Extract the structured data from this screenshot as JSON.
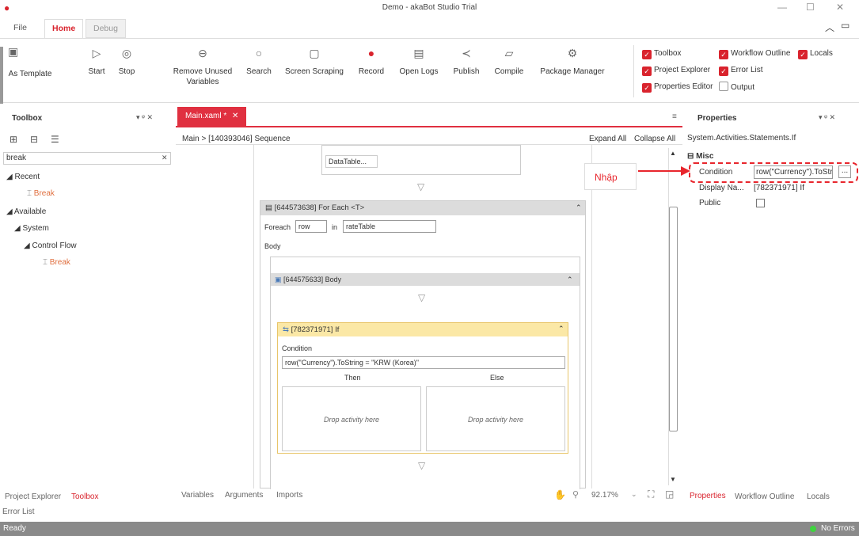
{
  "window": {
    "title": "Demo - akaBot Studio Trial"
  },
  "menu": {
    "file": "File",
    "home": "Home",
    "debug": "Debug"
  },
  "ribbon": {
    "as_template": "As Template",
    "start": "Start",
    "stop": "Stop",
    "remove_unused": "Remove Unused\nVariables",
    "search": "Search",
    "screen_scraping": "Screen Scraping",
    "record": "Record",
    "open_logs": "Open Logs",
    "publish": "Publish",
    "compile": "Compile",
    "package_manager": "Package Manager"
  },
  "panels": {
    "toolbox": "Toolbox",
    "workflow_outline": "Workflow Outline",
    "locals": "Locals",
    "project_explorer": "Project Explorer",
    "error_list": "Error List",
    "properties_editor": "Properties Editor",
    "output": "Output"
  },
  "toolbox": {
    "title": "Toolbox",
    "search_value": "break",
    "recent": "Recent",
    "break1": "Break",
    "available": "Available",
    "system": "System",
    "control_flow": "Control Flow",
    "break2": "Break"
  },
  "designer": {
    "tab": "Main.xaml *",
    "crumb": "Main > [140393046] Sequence",
    "expand": "Expand All",
    "collapse": "Collapse All",
    "datatable": "DataTable...",
    "foreach_title": "[644573638] For Each <T>",
    "foreach_label": "Foreach",
    "row": "row",
    "in_label": "in",
    "table": "rateTable",
    "body_label": "Body",
    "body_title": "[644575633] Body",
    "if_title": "[782371971] If",
    "condition_label": "Condition",
    "condition_value": "row(\"Currency\").ToString = \"KRW (Korea)\"",
    "then": "Then",
    "else": "Else",
    "drop1": "Drop activity here",
    "drop2": "Drop activity here"
  },
  "bottom": {
    "variables": "Variables",
    "arguments": "Arguments",
    "imports": "Imports",
    "zoom": "92.17%",
    "project_explorer": "Project Explorer",
    "toolbox": "Toolbox",
    "error_list": "Error List",
    "properties": "Properties",
    "workflow_outline": "Workflow Outline",
    "locals": "Locals"
  },
  "properties": {
    "title": "Properties",
    "type": "System.Activities.Statements.If",
    "misc": "Misc",
    "condition": "Condition",
    "condition_value": "row(\"Currency\").ToStri",
    "display_name": "Display Na...",
    "display_value": "[782371971] If",
    "public": "Public",
    "ellipsis": "..."
  },
  "annotation": {
    "text": "Nhập"
  },
  "status": {
    "ready": "Ready",
    "errors": "No Errors"
  },
  "colors": {
    "accent": "#d9232d",
    "annotation": "#e8262d"
  }
}
